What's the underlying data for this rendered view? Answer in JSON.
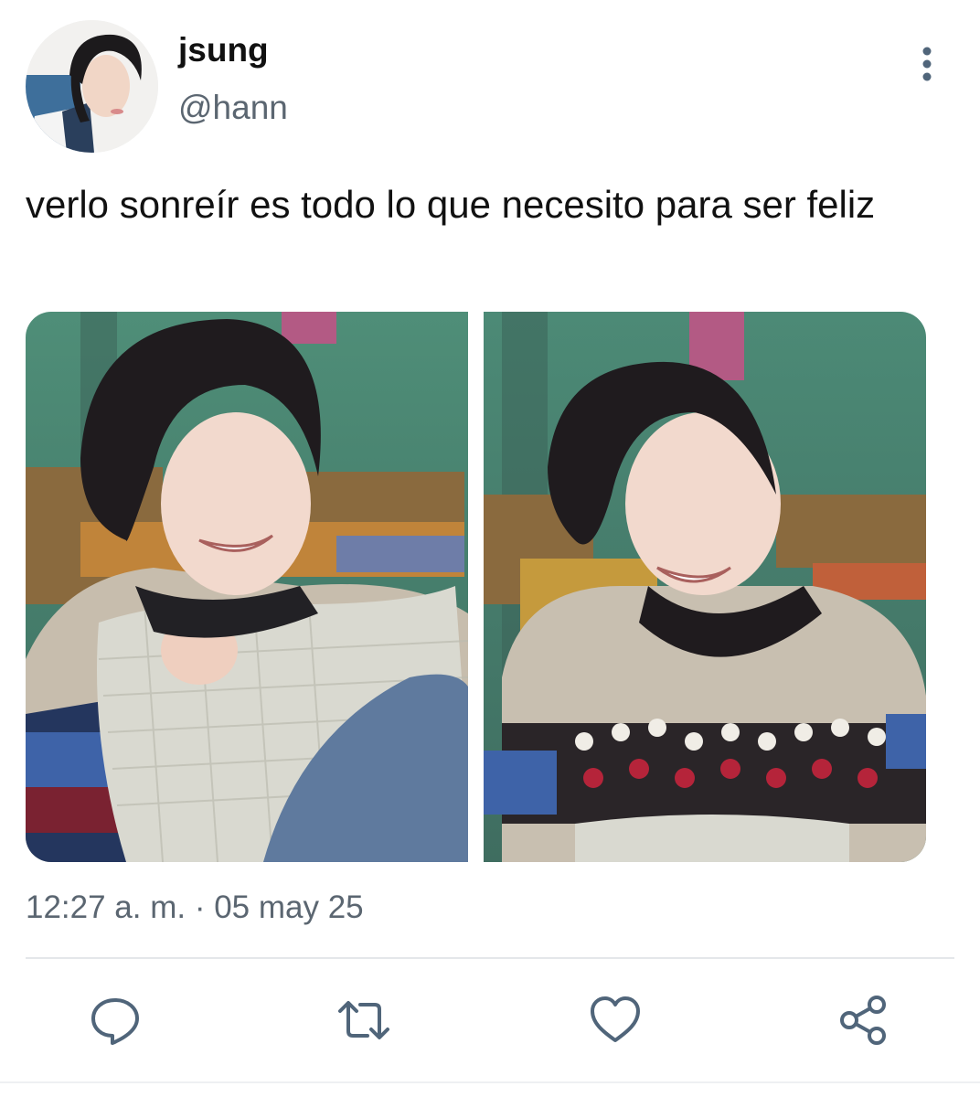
{
  "tweet": {
    "display_name": "jsung",
    "handle": "@hann",
    "text": "verlo sonreír es todo lo que necesito para ser feliz",
    "timestamp": "12:27 a. m. · 05 may 25",
    "media": [
      {
        "kind": "photo",
        "subject": "smiling-person-with-pillow"
      },
      {
        "kind": "photo",
        "subject": "laughing-person-knit-sweater"
      }
    ]
  },
  "icons": {
    "more": "more-vertical-icon",
    "reply": "reply-icon",
    "retweet": "retweet-icon",
    "like": "heart-icon",
    "share": "share-icon"
  },
  "colors": {
    "text": "#111111",
    "secondary": "#5b6671",
    "icon": "#50657a",
    "divider": "#e4e7ea"
  }
}
